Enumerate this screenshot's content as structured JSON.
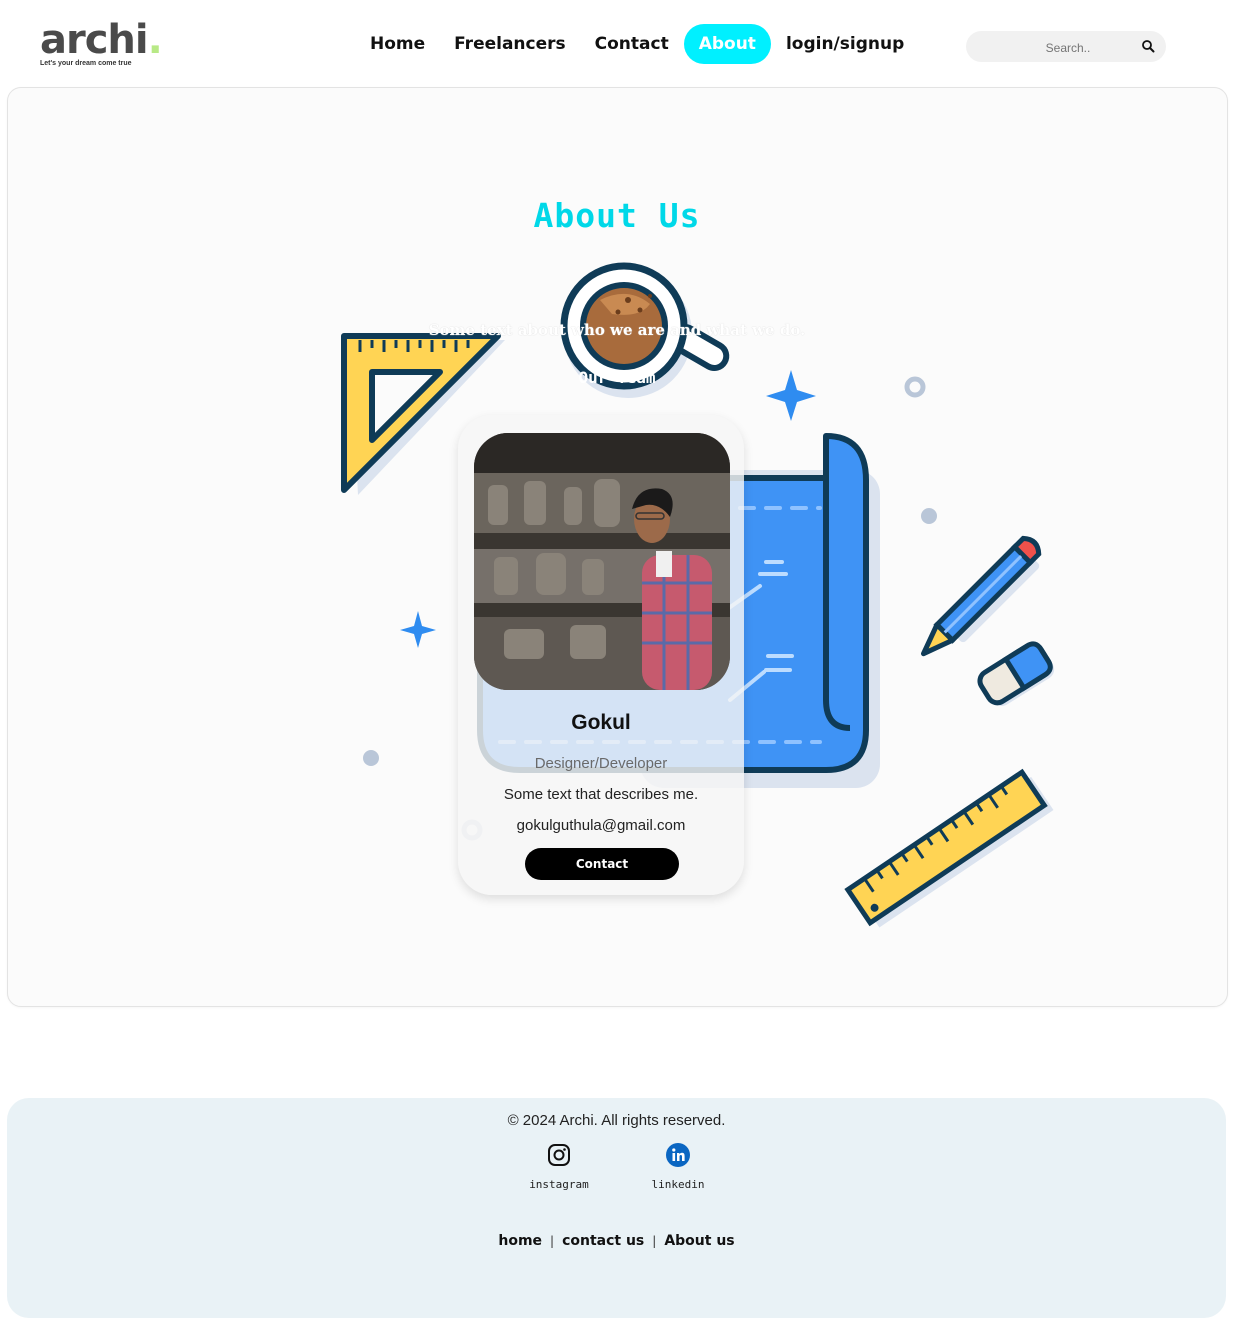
{
  "header": {
    "logo_text": "archi",
    "logo_dot": ".",
    "logo_tagline": "Let's your dream come true",
    "nav": [
      {
        "label": "Home",
        "active": false
      },
      {
        "label": "Freelancers",
        "active": false
      },
      {
        "label": "Contact",
        "active": false
      },
      {
        "label": "About",
        "active": true
      },
      {
        "label": "login/signup",
        "active": false
      }
    ],
    "search_placeholder": "Search..",
    "accent_color": "#00f0ff"
  },
  "about": {
    "title": "About Us",
    "subtitle": "Some text about who we are and what we do.",
    "team_heading": "Our Team",
    "title_color": "#00d8e8"
  },
  "card": {
    "name": "Gokul",
    "role": "Designer/Developer",
    "description": "Some text that describes me.",
    "email": "gokulguthula@gmail.com",
    "button_label": "Contact"
  },
  "footer": {
    "copyright": "© 2024 Archi. All rights reserved.",
    "social": [
      {
        "label": "instagram",
        "icon": "instagram-icon"
      },
      {
        "label": "linkedin",
        "icon": "linkedin-icon"
      }
    ],
    "links": [
      {
        "label": "home"
      },
      {
        "label": "contact us"
      },
      {
        "label": "About us"
      }
    ],
    "separator": "|",
    "background_color": "#e9f2f6"
  }
}
